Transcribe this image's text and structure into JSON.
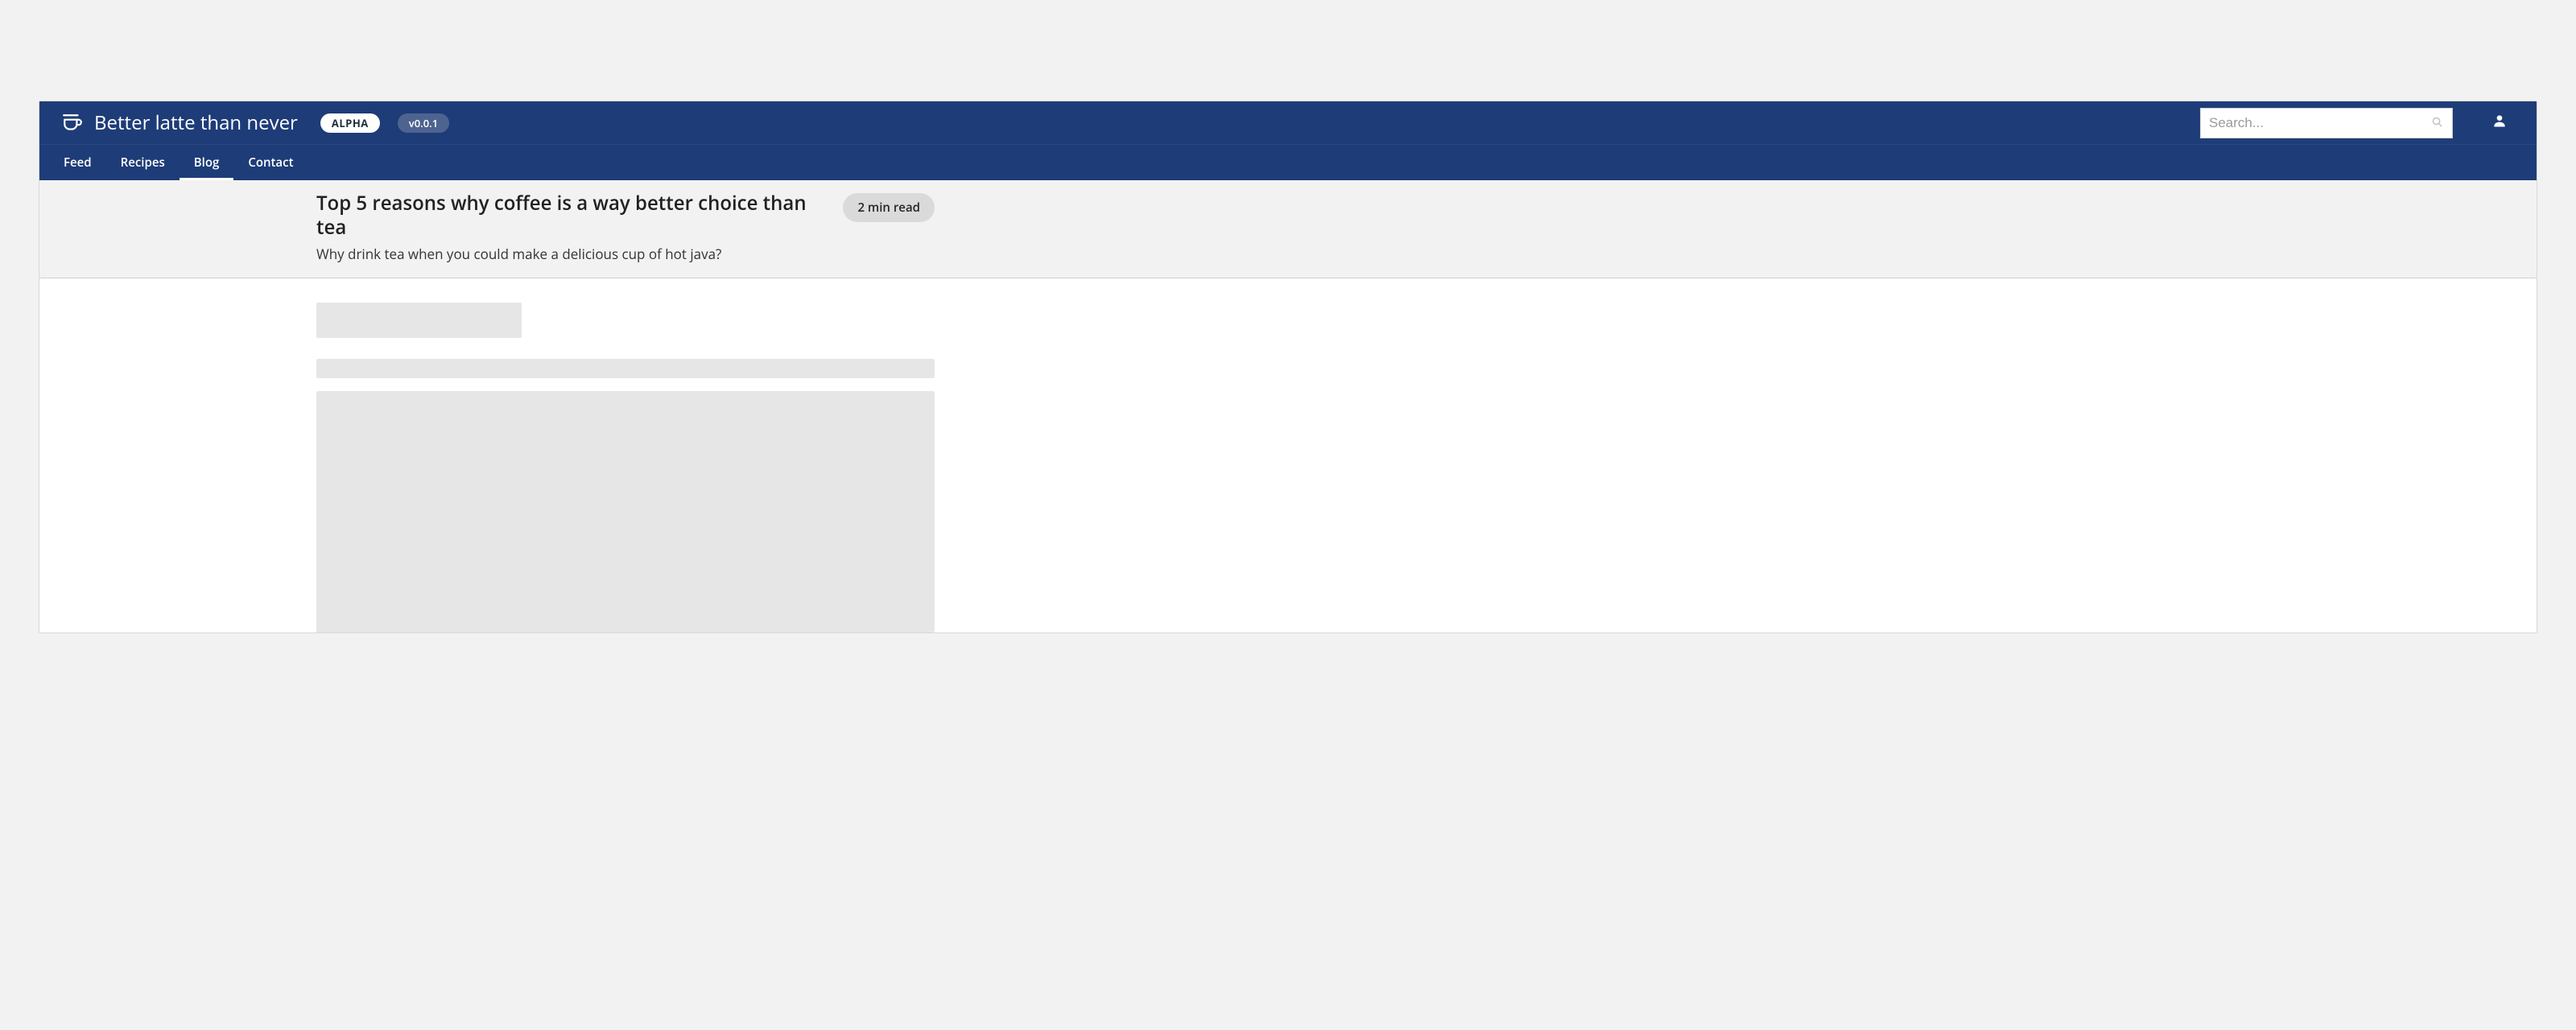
{
  "colors": {
    "brand": "#1e3c78",
    "header_bg": "#f2f2f2",
    "chip_bg": "#dadada",
    "skeleton": "#e6e6e6"
  },
  "topbar": {
    "title": "Better latte than never",
    "badge_label": "ALPHA",
    "version_label": "v0.0.1",
    "search_placeholder": "Search..."
  },
  "nav": {
    "items": [
      {
        "label": "Feed",
        "active": false
      },
      {
        "label": "Recipes",
        "active": false
      },
      {
        "label": "Blog",
        "active": true
      },
      {
        "label": "Contact",
        "active": false
      }
    ]
  },
  "article": {
    "title": "Top 5 reasons why coffee is a way better choice than tea",
    "subtitle": "Why drink tea when you could make a delicious cup of hot java?",
    "readtime_label": "2 min read"
  }
}
